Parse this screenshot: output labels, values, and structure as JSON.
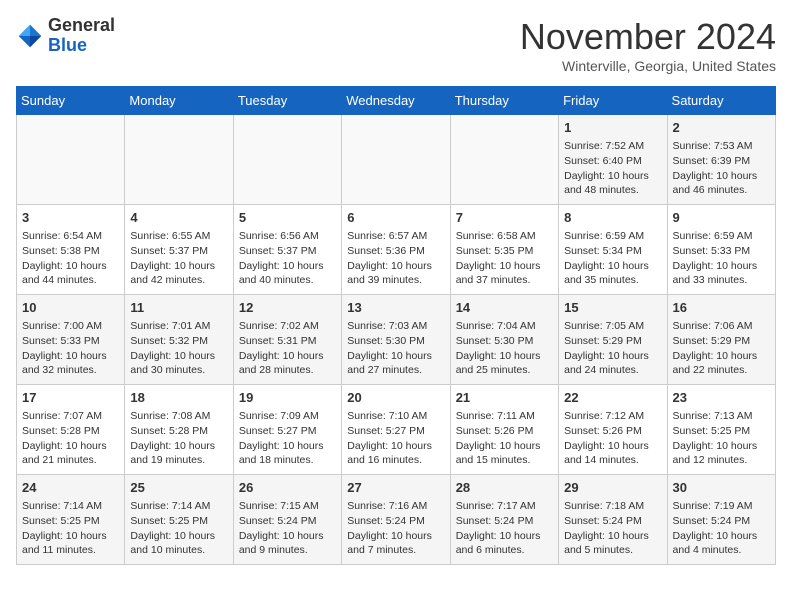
{
  "header": {
    "logo_general": "General",
    "logo_blue": "Blue",
    "month_title": "November 2024",
    "location": "Winterville, Georgia, United States"
  },
  "weekdays": [
    "Sunday",
    "Monday",
    "Tuesday",
    "Wednesday",
    "Thursday",
    "Friday",
    "Saturday"
  ],
  "weeks": [
    [
      {
        "day": "",
        "info": ""
      },
      {
        "day": "",
        "info": ""
      },
      {
        "day": "",
        "info": ""
      },
      {
        "day": "",
        "info": ""
      },
      {
        "day": "",
        "info": ""
      },
      {
        "day": "1",
        "info": "Sunrise: 7:52 AM\nSunset: 6:40 PM\nDaylight: 10 hours and 48 minutes."
      },
      {
        "day": "2",
        "info": "Sunrise: 7:53 AM\nSunset: 6:39 PM\nDaylight: 10 hours and 46 minutes."
      }
    ],
    [
      {
        "day": "3",
        "info": "Sunrise: 6:54 AM\nSunset: 5:38 PM\nDaylight: 10 hours and 44 minutes."
      },
      {
        "day": "4",
        "info": "Sunrise: 6:55 AM\nSunset: 5:37 PM\nDaylight: 10 hours and 42 minutes."
      },
      {
        "day": "5",
        "info": "Sunrise: 6:56 AM\nSunset: 5:37 PM\nDaylight: 10 hours and 40 minutes."
      },
      {
        "day": "6",
        "info": "Sunrise: 6:57 AM\nSunset: 5:36 PM\nDaylight: 10 hours and 39 minutes."
      },
      {
        "day": "7",
        "info": "Sunrise: 6:58 AM\nSunset: 5:35 PM\nDaylight: 10 hours and 37 minutes."
      },
      {
        "day": "8",
        "info": "Sunrise: 6:59 AM\nSunset: 5:34 PM\nDaylight: 10 hours and 35 minutes."
      },
      {
        "day": "9",
        "info": "Sunrise: 6:59 AM\nSunset: 5:33 PM\nDaylight: 10 hours and 33 minutes."
      }
    ],
    [
      {
        "day": "10",
        "info": "Sunrise: 7:00 AM\nSunset: 5:33 PM\nDaylight: 10 hours and 32 minutes."
      },
      {
        "day": "11",
        "info": "Sunrise: 7:01 AM\nSunset: 5:32 PM\nDaylight: 10 hours and 30 minutes."
      },
      {
        "day": "12",
        "info": "Sunrise: 7:02 AM\nSunset: 5:31 PM\nDaylight: 10 hours and 28 minutes."
      },
      {
        "day": "13",
        "info": "Sunrise: 7:03 AM\nSunset: 5:30 PM\nDaylight: 10 hours and 27 minutes."
      },
      {
        "day": "14",
        "info": "Sunrise: 7:04 AM\nSunset: 5:30 PM\nDaylight: 10 hours and 25 minutes."
      },
      {
        "day": "15",
        "info": "Sunrise: 7:05 AM\nSunset: 5:29 PM\nDaylight: 10 hours and 24 minutes."
      },
      {
        "day": "16",
        "info": "Sunrise: 7:06 AM\nSunset: 5:29 PM\nDaylight: 10 hours and 22 minutes."
      }
    ],
    [
      {
        "day": "17",
        "info": "Sunrise: 7:07 AM\nSunset: 5:28 PM\nDaylight: 10 hours and 21 minutes."
      },
      {
        "day": "18",
        "info": "Sunrise: 7:08 AM\nSunset: 5:28 PM\nDaylight: 10 hours and 19 minutes."
      },
      {
        "day": "19",
        "info": "Sunrise: 7:09 AM\nSunset: 5:27 PM\nDaylight: 10 hours and 18 minutes."
      },
      {
        "day": "20",
        "info": "Sunrise: 7:10 AM\nSunset: 5:27 PM\nDaylight: 10 hours and 16 minutes."
      },
      {
        "day": "21",
        "info": "Sunrise: 7:11 AM\nSunset: 5:26 PM\nDaylight: 10 hours and 15 minutes."
      },
      {
        "day": "22",
        "info": "Sunrise: 7:12 AM\nSunset: 5:26 PM\nDaylight: 10 hours and 14 minutes."
      },
      {
        "day": "23",
        "info": "Sunrise: 7:13 AM\nSunset: 5:25 PM\nDaylight: 10 hours and 12 minutes."
      }
    ],
    [
      {
        "day": "24",
        "info": "Sunrise: 7:14 AM\nSunset: 5:25 PM\nDaylight: 10 hours and 11 minutes."
      },
      {
        "day": "25",
        "info": "Sunrise: 7:14 AM\nSunset: 5:25 PM\nDaylight: 10 hours and 10 minutes."
      },
      {
        "day": "26",
        "info": "Sunrise: 7:15 AM\nSunset: 5:24 PM\nDaylight: 10 hours and 9 minutes."
      },
      {
        "day": "27",
        "info": "Sunrise: 7:16 AM\nSunset: 5:24 PM\nDaylight: 10 hours and 7 minutes."
      },
      {
        "day": "28",
        "info": "Sunrise: 7:17 AM\nSunset: 5:24 PM\nDaylight: 10 hours and 6 minutes."
      },
      {
        "day": "29",
        "info": "Sunrise: 7:18 AM\nSunset: 5:24 PM\nDaylight: 10 hours and 5 minutes."
      },
      {
        "day": "30",
        "info": "Sunrise: 7:19 AM\nSunset: 5:24 PM\nDaylight: 10 hours and 4 minutes."
      }
    ]
  ]
}
